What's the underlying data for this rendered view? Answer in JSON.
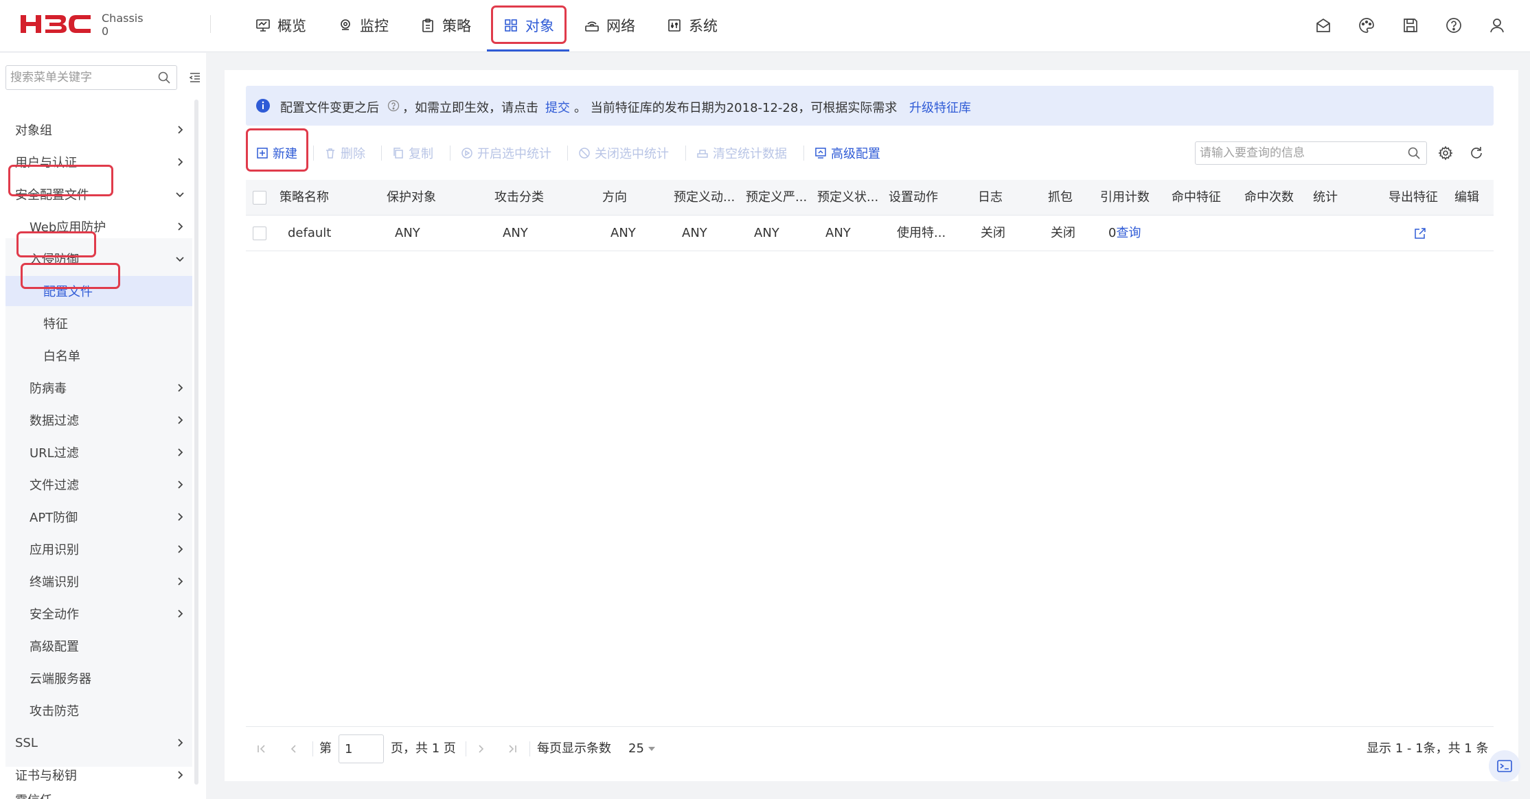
{
  "header": {
    "logo_sub_line1": "Chassis",
    "logo_sub_line2": "0",
    "nav": [
      {
        "label": "概览",
        "icon": "monitor-icon"
      },
      {
        "label": "监控",
        "icon": "location-icon"
      },
      {
        "label": "策略",
        "icon": "clipboard-icon"
      },
      {
        "label": "对象",
        "icon": "grid-icon",
        "active": true
      },
      {
        "label": "网络",
        "icon": "network-icon"
      },
      {
        "label": "系统",
        "icon": "system-icon"
      }
    ],
    "right_icons": [
      "mail-icon",
      "palette-icon",
      "save-icon",
      "help-icon",
      "user-icon"
    ]
  },
  "sidebar": {
    "search_placeholder": "搜索菜单关键字",
    "items": [
      {
        "label": "对象组",
        "level": 0
      },
      {
        "label": "用户与认证",
        "level": 0
      },
      {
        "label": "安全配置文件",
        "level": 0,
        "expanded": true
      },
      {
        "label": "Web应用防护",
        "level": 1
      },
      {
        "label": "入侵防御",
        "level": 1,
        "expanded": true
      },
      {
        "label": "配置文件",
        "level": 2,
        "selected": true
      },
      {
        "label": "特征",
        "level": 2
      },
      {
        "label": "白名单",
        "level": 2
      },
      {
        "label": "防病毒",
        "level": 1
      },
      {
        "label": "数据过滤",
        "level": 1
      },
      {
        "label": "URL过滤",
        "level": 1
      },
      {
        "label": "文件过滤",
        "level": 1
      },
      {
        "label": "APT防御",
        "level": 1
      },
      {
        "label": "应用识别",
        "level": 1
      },
      {
        "label": "终端识别",
        "level": 1
      },
      {
        "label": "安全动作",
        "level": 1
      },
      {
        "label": "高级配置",
        "level": 1
      },
      {
        "label": "云端服务器",
        "level": 1
      },
      {
        "label": "攻击防范",
        "level": 1
      },
      {
        "label": "SSL",
        "level": 0
      },
      {
        "label": "证书与秘钥",
        "level": 0
      },
      {
        "label": "零信任",
        "level": 0
      }
    ]
  },
  "notice": {
    "text1": "配置文件变更之后",
    "text2": "，如需立即生效，请点击",
    "link1": "提交",
    "text3": "。 当前特征库的发布日期为2018-12-28，可根据实际需求",
    "link2": "升级特征库"
  },
  "toolbar": {
    "new": "新建",
    "delete": "删除",
    "copy": "复制",
    "enable_stats": "开启选中统计",
    "disable_stats": "关闭选中统计",
    "clear_stats": "清空统计数据",
    "advanced": "高级配置",
    "search_placeholder": "请输入要查询的信息"
  },
  "table": {
    "columns": [
      "策略名称",
      "保护对象",
      "攻击分类",
      "方向",
      "预定义动...",
      "预定义严...",
      "预定义状...",
      "设置动作",
      "日志",
      "抓包",
      "引用计数",
      "命中特征",
      "命中次数",
      "统计",
      "导出特征",
      "编辑"
    ],
    "rows": [
      {
        "name": "default",
        "protect": "ANY",
        "attack": "ANY",
        "direction": "ANY",
        "pre_action": "ANY",
        "pre_severity": "ANY",
        "pre_status": "ANY",
        "set_action": "使用特...",
        "log": "关闭",
        "capture": "关闭",
        "ref_count": "0",
        "ref_link": "查询"
      }
    ]
  },
  "pagination": {
    "page_prefix": "第",
    "page_value": "1",
    "page_suffix": "页，共 1 页",
    "per_page_label": "每页显示条数",
    "per_page_value": "25",
    "summary": "显示 1 - 1条，共 1 条"
  },
  "colors": {
    "accent": "#2f5bd6",
    "highlight_box": "#e03b4b",
    "notice_bg": "#e6ecfb",
    "logo_red": "#d4202c"
  }
}
